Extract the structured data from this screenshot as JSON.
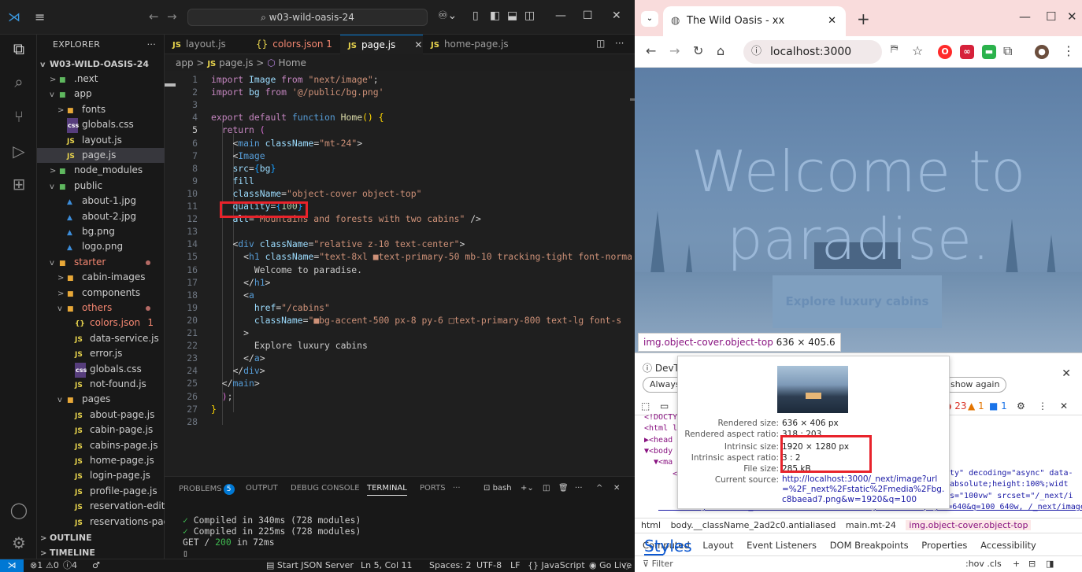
{
  "vscode": {
    "search_title": "w03-wild-oasis-24",
    "activity": [
      "files-icon",
      "search-icon",
      "source-control-icon",
      "run-debug-icon",
      "extensions-icon",
      "account-icon",
      "manage-icon"
    ],
    "explorer": {
      "header": "EXPLORER",
      "more": "···",
      "project": "W03-WILD-OASIS-24",
      "rows": [
        {
          "label": ".next",
          "indent": 1,
          "chev": ">",
          "icon": "folder-next-icon",
          "glyph": "■",
          "cls": "fi-green"
        },
        {
          "label": "app",
          "indent": 1,
          "chev": "v",
          "icon": "folder-app-icon",
          "glyph": "■",
          "cls": "fi-green"
        },
        {
          "label": "fonts",
          "indent": 2,
          "chev": ">",
          "icon": "folder-fonts-icon",
          "glyph": "■",
          "cls": "fi-folder"
        },
        {
          "label": "globals.css",
          "indent": 2,
          "chev": "",
          "icon": "css-file-icon",
          "glyph": "css",
          "cls": "fi-css"
        },
        {
          "label": "layout.js",
          "indent": 2,
          "chev": "",
          "icon": "js-file-icon",
          "glyph": "JS",
          "cls": "fi-js"
        },
        {
          "label": "page.js",
          "indent": 2,
          "chev": "",
          "icon": "js-file-icon",
          "glyph": "JS",
          "cls": "fi-js",
          "sel": true
        },
        {
          "label": "node_modules",
          "indent": 1,
          "chev": ">",
          "icon": "folder-node-icon",
          "glyph": "■",
          "cls": "fi-green"
        },
        {
          "label": "public",
          "indent": 1,
          "chev": "v",
          "icon": "folder-public-icon",
          "glyph": "■",
          "cls": "fi-green"
        },
        {
          "label": "about-1.jpg",
          "indent": 2,
          "chev": "",
          "icon": "image-file-icon",
          "glyph": "▲",
          "cls": "fi-img"
        },
        {
          "label": "about-2.jpg",
          "indent": 2,
          "chev": "",
          "icon": "image-file-icon",
          "glyph": "▲",
          "cls": "fi-img"
        },
        {
          "label": "bg.png",
          "indent": 2,
          "chev": "",
          "icon": "image-file-icon",
          "glyph": "▲",
          "cls": "fi-img"
        },
        {
          "label": "logo.png",
          "indent": 2,
          "chev": "",
          "icon": "image-file-icon",
          "glyph": "▲",
          "cls": "fi-img"
        },
        {
          "label": "starter",
          "indent": 1,
          "chev": "v",
          "icon": "folder-starter-icon",
          "glyph": "■",
          "cls": "fi-folder",
          "red": true,
          "dot": true
        },
        {
          "label": "cabin-images",
          "indent": 2,
          "chev": ">",
          "icon": "folder-icon",
          "glyph": "■",
          "cls": "fi-folder"
        },
        {
          "label": "components",
          "indent": 2,
          "chev": ">",
          "icon": "folder-icon",
          "glyph": "■",
          "cls": "fi-folder"
        },
        {
          "label": "others",
          "indent": 2,
          "chev": "v",
          "icon": "folder-icon",
          "glyph": "■",
          "cls": "fi-folder",
          "red": true,
          "dot": true
        },
        {
          "label": "colors.json",
          "indent": 3,
          "chev": "",
          "icon": "json-file-icon",
          "glyph": "{}",
          "cls": "fi-json",
          "red": true,
          "badge": "1"
        },
        {
          "label": "data-service.js",
          "indent": 3,
          "chev": "",
          "icon": "js-file-icon",
          "glyph": "JS",
          "cls": "fi-js"
        },
        {
          "label": "error.js",
          "indent": 3,
          "chev": "",
          "icon": "js-file-icon",
          "glyph": "JS",
          "cls": "fi-js"
        },
        {
          "label": "globals.css",
          "indent": 3,
          "chev": "",
          "icon": "css-file-icon",
          "glyph": "css",
          "cls": "fi-css"
        },
        {
          "label": "not-found.js",
          "indent": 3,
          "chev": "",
          "icon": "js-file-icon",
          "glyph": "JS",
          "cls": "fi-js"
        },
        {
          "label": "pages",
          "indent": 2,
          "chev": "v",
          "icon": "folder-icon",
          "glyph": "■",
          "cls": "fi-folder"
        },
        {
          "label": "about-page.js",
          "indent": 3,
          "chev": "",
          "icon": "js-file-icon",
          "glyph": "JS",
          "cls": "fi-js"
        },
        {
          "label": "cabin-page.js",
          "indent": 3,
          "chev": "",
          "icon": "js-file-icon",
          "glyph": "JS",
          "cls": "fi-js"
        },
        {
          "label": "cabins-page.js",
          "indent": 3,
          "chev": "",
          "icon": "js-file-icon",
          "glyph": "JS",
          "cls": "fi-js"
        },
        {
          "label": "home-page.js",
          "indent": 3,
          "chev": "",
          "icon": "js-file-icon",
          "glyph": "JS",
          "cls": "fi-js"
        },
        {
          "label": "login-page.js",
          "indent": 3,
          "chev": "",
          "icon": "js-file-icon",
          "glyph": "JS",
          "cls": "fi-js"
        },
        {
          "label": "profile-page.js",
          "indent": 3,
          "chev": "",
          "icon": "js-file-icon",
          "glyph": "JS",
          "cls": "fi-js"
        },
        {
          "label": "reservation-edit-...",
          "indent": 3,
          "chev": "",
          "icon": "js-file-icon",
          "glyph": "JS",
          "cls": "fi-js"
        },
        {
          "label": "reservations-pag...",
          "indent": 3,
          "chev": "",
          "icon": "js-file-icon",
          "glyph": "JS",
          "cls": "fi-js"
        }
      ],
      "outline": "OUTLINE",
      "timeline": "TIMELINE"
    },
    "tabs": [
      {
        "label": "layout.js",
        "type": "JS"
      },
      {
        "label": "colors.json",
        "type": "{}",
        "err": "1"
      },
      {
        "label": "page.js",
        "type": "JS",
        "active": true
      },
      {
        "label": "home-page.js",
        "type": "JS"
      }
    ],
    "breadcrumb": {
      "folder": "app",
      "sep": ">",
      "file": "page.js",
      "symbol": "Home"
    },
    "code": [
      "<span class=\"kw\">import</span> <span class=\"var\">Image</span> <span class=\"kw\">from</span> <span class=\"str\">\"next/image\"</span>;",
      "<span class=\"kw\">import</span> <span class=\"var\">bg</span> <span class=\"kw\">from</span> <span class=\"str\">'@/public/bg.png'</span>",
      "",
      "<span class=\"kw\">export</span> <span class=\"kw\">default</span> <span class=\"kb\">function</span> <span class=\"fn\">Home</span><span class=\"yel\">()</span> <span class=\"yel\">{</span>",
      "  <span class=\"kw\">return</span> <span class=\"brace2\">(</span>",
      "    <span class=\"br\">&lt;</span><span class=\"tag\">main</span> <span class=\"attr\">className</span>=<span class=\"str\">\"mt-24\"</span><span class=\"br\">&gt;</span>",
      "    <span class=\"br\">&lt;</span><span class=\"tag\">Image</span>",
      "    <span class=\"attr\">src</span>=<span class=\"brace3\">{</span><span class=\"var\">bg</span><span class=\"brace3\">}</span>",
      "    <span class=\"attr\">fill</span>",
      "    <span class=\"attr\">className</span>=<span class=\"str\">\"object-cover object-top\"</span>",
      "    <span class=\"attr\">quality</span>=<span class=\"brace3\">{</span><span class=\"num\">100</span><span class=\"brace3\">}</span>",
      "    <span class=\"attr\">alt</span>=<span class=\"str\">\"Mountains and forests with two cabins\"</span> <span class=\"br\">/&gt;</span>",
      "",
      "    <span class=\"br\">&lt;</span><span class=\"tag\">div</span> <span class=\"attr\">className</span>=<span class=\"str\">\"relative z-10 text-center\"</span><span class=\"br\">&gt;</span>",
      "      <span class=\"br\">&lt;</span><span class=\"tag\">h1</span> <span class=\"attr\">className</span>=<span class=\"str\">\"text-8xl ■text-primary-50 mb-10 tracking-tight font-norma</span>",
      "        Welcome to paradise.",
      "      <span class=\"br\">&lt;/</span><span class=\"tag\">h1</span><span class=\"br\">&gt;</span>",
      "      <span class=\"br\">&lt;</span><span class=\"tag\">a</span>",
      "        <span class=\"attr\">href</span>=<span class=\"str\">\"/cabins\"</span>",
      "        <span class=\"attr\">className</span>=<span class=\"str\">\"■bg-accent-500 px-8 py-6 □text-primary-800 text-lg font-s</span>",
      "      <span class=\"br\">&gt;</span>",
      "        Explore luxury cabins",
      "      <span class=\"br\">&lt;/</span><span class=\"tag\">a</span><span class=\"br\">&gt;</span>",
      "    <span class=\"br\">&lt;/</span><span class=\"tag\">div</span><span class=\"br\">&gt;</span>",
      "  <span class=\"br\">&lt;/</span><span class=\"tag\">main</span><span class=\"br\">&gt;</span>",
      "  <span class=\"brace2\">)</span>;",
      "<span class=\"yel\">}</span>",
      ""
    ],
    "panel": {
      "tabs": [
        "PROBLEMS",
        "OUTPUT",
        "DEBUG CONSOLE",
        "TERMINAL",
        "PORTS",
        "···"
      ],
      "problems_count": "5",
      "shell": "bash",
      "lines": [
        {
          "check": "✓",
          "text": " Compiled in 340ms (728 modules)"
        },
        {
          "check": "✓",
          "text": " Compiled in 225ms (728 modules)"
        },
        {
          "pre": "GET / ",
          "status": "200",
          "post": " in 72ms"
        }
      ],
      "cursor": "▯"
    },
    "status": {
      "errors": "⊗1",
      "warnings": "⚠0",
      "info": "ⓘ4",
      "json_server": "Start JSON Server",
      "position": "Ln 5, Col 11",
      "spaces": "Spaces: 2",
      "encoding": "UTF-8",
      "eol": "LF",
      "language": "{} JavaScript",
      "golive": "Go Live"
    }
  },
  "chrome": {
    "tab_title": "The Wild Oasis - xx",
    "url": "localhost:3000",
    "hero_line1": "Welcome to",
    "hero_line2": "paradise.",
    "hero_button": "Explore luxury cabins",
    "inspect_selector": "img.object-cover.object-top",
    "inspect_size": "636 × 405.6",
    "devtools": {
      "info": "DevTools",
      "pill_always": "Always",
      "pill_show": "show again",
      "counts": {
        "errors": "23",
        "warnings": "1",
        "messages": "1"
      },
      "dom_lines": [
        "<!DOCTYPE h",
        "<html l",
        "▶<head",
        "▼<body",
        "  ▼<ma",
        "      <i",
        "       n",
        "       h",
        "       mage?url=%2F_next%2Fstatic%2Fmedia%2Fbg.c8baead7.png&w=640&q=100 640w, /_next/image?ur"
      ],
      "dom_right": [
        "ty\" decoding=\"async\" data-",
        "absolute;height:100%;widt",
        "s=\"100vw\" srcset=\"/_next/i"
      ],
      "crumbs": [
        "html",
        "body.__className_2ad2c0.antialiased",
        "main.mt-24",
        "img.object-cover.object-top"
      ],
      "subtabs": [
        "Styles",
        "Computed",
        "Layout",
        "Event Listeners",
        "DOM Breakpoints",
        "Properties",
        "Accessibility"
      ],
      "filter": "Filter",
      "filter_right": ":hov .cls"
    },
    "tooltip": {
      "rendered_size_k": "Rendered size:",
      "rendered_size_v": "636 × 406 px",
      "rendered_aspect_k": "Rendered aspect ratio:",
      "rendered_aspect_v": "318 : 203",
      "intrinsic_size_k": "Intrinsic size:",
      "intrinsic_size_v": "1920 × 1280 px",
      "intrinsic_aspect_k": "Intrinsic aspect ratio:",
      "intrinsic_aspect_v": "3 : 2",
      "file_size_k": "File size:",
      "file_size_v": "285 kB",
      "source_k": "Current source:",
      "source_v": "http://localhost:3000/_next/image?url=%2F_next%2Fstatic%2Fmedia%2Fbg.c8baead7.png&w=1920&q=100"
    }
  }
}
